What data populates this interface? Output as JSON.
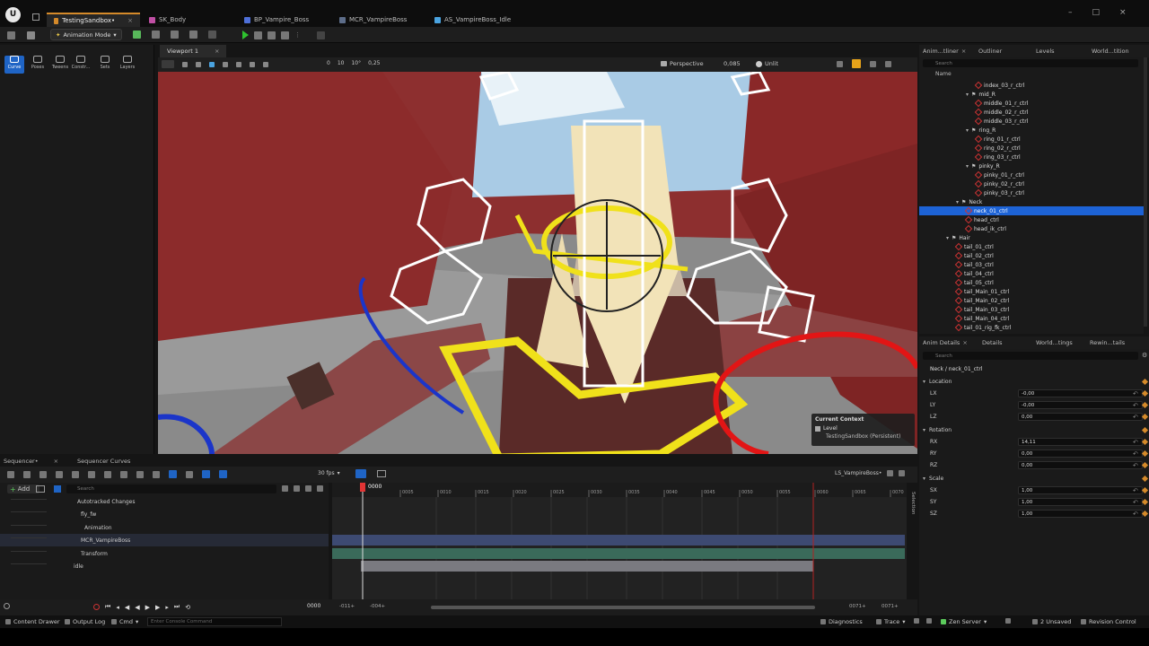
{
  "window": {
    "tabs": [
      {
        "label": "TestingSandbox•",
        "active": true,
        "color": "#d58a2a"
      },
      {
        "label": "SK_Body",
        "color": "#c04fa4"
      },
      {
        "label": "BP_Vampire_Boss",
        "color": "#4e6fd8"
      },
      {
        "label": "MCR_VampireBoss",
        "color": "#5d6d89"
      },
      {
        "label": "AS_VampireBoss_Idle",
        "color": "#4aa3e0"
      }
    ],
    "logo": "U"
  },
  "toolbar": {
    "mode_label": "Animation Mode"
  },
  "anim_tools": [
    "Curve",
    "Poses",
    "Tweens",
    "Constr...",
    "Sets",
    "Layers"
  ],
  "viewport": {
    "tab_label": "Viewport 1",
    "perspective": "Perspective",
    "lit": "Unlit",
    "snap_values": [
      "0",
      "10",
      "10°",
      "0,25"
    ],
    "camera_speed": "0,085",
    "context": {
      "title": "Current Context",
      "level": "Level",
      "level_value": "TestingSandbox (Persistent)"
    }
  },
  "outliner": {
    "tabs": [
      "Anim...tliner",
      "Outliner",
      "Levels",
      "World...tition"
    ],
    "search_placeholder": "Search",
    "name_header": "Name",
    "rows": [
      {
        "label": "index_03_r_ctrl",
        "depth": 5
      },
      {
        "label": "mid_R",
        "depth": 4,
        "group": true
      },
      {
        "label": "middle_01_r_ctrl",
        "depth": 5
      },
      {
        "label": "middle_02_r_ctrl",
        "depth": 5
      },
      {
        "label": "middle_03_r_ctrl",
        "depth": 5
      },
      {
        "label": "ring_R",
        "depth": 4,
        "group": true
      },
      {
        "label": "ring_01_r_ctrl",
        "depth": 5
      },
      {
        "label": "ring_02_r_ctrl",
        "depth": 5
      },
      {
        "label": "ring_03_r_ctrl",
        "depth": 5
      },
      {
        "label": "pinky_R",
        "depth": 4,
        "group": true
      },
      {
        "label": "pinky_01_r_ctrl",
        "depth": 5
      },
      {
        "label": "pinky_02_r_ctrl",
        "depth": 5
      },
      {
        "label": "pinky_03_r_ctrl",
        "depth": 5
      },
      {
        "label": "Neck",
        "depth": 3,
        "group": true
      },
      {
        "label": "neck_01_ctrl",
        "depth": 4,
        "selected": true
      },
      {
        "label": "head_ctrl",
        "depth": 4
      },
      {
        "label": "head_ik_ctrl",
        "depth": 4
      },
      {
        "label": "Hair",
        "depth": 2,
        "group": true
      },
      {
        "label": "tail_01_ctrl",
        "depth": 3
      },
      {
        "label": "tail_02_ctrl",
        "depth": 3
      },
      {
        "label": "tail_03_ctrl",
        "depth": 3
      },
      {
        "label": "tail_04_ctrl",
        "depth": 3
      },
      {
        "label": "tail_05_ctrl",
        "depth": 3
      },
      {
        "label": "tail_Main_01_ctrl",
        "depth": 3
      },
      {
        "label": "tail_Main_02_ctrl",
        "depth": 3
      },
      {
        "label": "tail_Main_03_ctrl",
        "depth": 3
      },
      {
        "label": "tail_Main_04_ctrl",
        "depth": 3
      },
      {
        "label": "tail_01_rig_fk_ctrl",
        "depth": 3
      }
    ]
  },
  "details": {
    "tabs": [
      "Anim Details",
      "Details",
      "World...tings",
      "Rewin...tails"
    ],
    "search_placeholder": "Search",
    "path": "Neck / neck_01_ctrl",
    "sections": {
      "location": "Location",
      "rotation": "Rotation",
      "scale": "Scale"
    },
    "fields": [
      {
        "label": "LX",
        "value": "-0,00"
      },
      {
        "label": "LY",
        "value": "-0,00"
      },
      {
        "label": "LZ",
        "value": "0,00"
      },
      {
        "label": "RX",
        "value": "14,11"
      },
      {
        "label": "RY",
        "value": "0,00"
      },
      {
        "label": "RZ",
        "value": "0,00"
      },
      {
        "label": "SX",
        "value": "1,00"
      },
      {
        "label": "SY",
        "value": "1,00"
      },
      {
        "label": "SZ",
        "value": "1,00"
      }
    ]
  },
  "sequencer": {
    "tabs": [
      "Sequencer•",
      "Sequencer Curves"
    ],
    "fps": "30 fps",
    "sequence_name": "LS_VampireBoss•",
    "add_label": "Add",
    "search_placeholder": "Search",
    "selection_label": "Selection",
    "tracks": [
      {
        "label": "Autotracked Changes"
      },
      {
        "label": "fly_fw"
      },
      {
        "label": "Animation"
      },
      {
        "label": "MCR_VampireBoss"
      },
      {
        "label": "Transform"
      },
      {
        "label": "idle"
      }
    ],
    "current_frame": "0000",
    "ruler": [
      "0005",
      "0010",
      "0015",
      "0020",
      "0025",
      "0030",
      "0035",
      "0040",
      "0045",
      "0050",
      "0055",
      "0060",
      "0065",
      "0070"
    ],
    "range_start": "-011+",
    "range_view_start": "-004+",
    "range_view_end": "0071+",
    "range_end": "0071+",
    "bottom_frame": "0000"
  },
  "statusbar": {
    "content_drawer": "Content Drawer",
    "output_log": "Output Log",
    "cmd": "Cmd",
    "console_placeholder": "Enter Console Command",
    "diagnostics": "Diagnostics",
    "trace": "Trace",
    "zen_server": "Zen Server",
    "unsaved": "2 Unsaved",
    "revision_control": "Revision Control"
  }
}
